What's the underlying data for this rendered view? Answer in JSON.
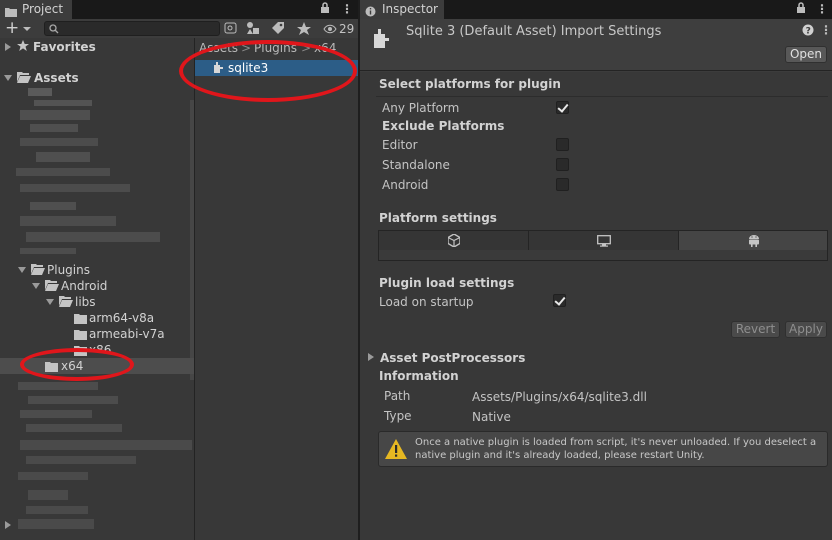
{
  "project_tab": {
    "title": "Project",
    "count": "29"
  },
  "inspector_tab": {
    "title": "Inspector"
  },
  "search": {
    "placeholder": ""
  },
  "tree": {
    "favorites": "Favorites",
    "assets": "Assets",
    "plugins": "Plugins",
    "android": "Android",
    "libs": "libs",
    "arm64": "arm64-v8a",
    "armeabi": "armeabi-v7a",
    "x86": "x86",
    "x64": "x64"
  },
  "breadcrumb": {
    "part1": "Assets",
    "sep1": ">",
    "part2": "Plugins",
    "sep2": ">",
    "part3": "x64"
  },
  "file_list": {
    "selected": "sqlite3"
  },
  "inspector": {
    "title": "Sqlite 3 (Default Asset) Import Settings",
    "open_button": "Open",
    "select_platforms_header": "Select platforms for plugin",
    "any_platform_label": "Any Platform",
    "any_platform_checked": true,
    "exclude_platforms_header": "Exclude Platforms",
    "exclude": [
      {
        "label": "Editor",
        "checked": false
      },
      {
        "label": "Standalone",
        "checked": false
      },
      {
        "label": "Android",
        "checked": false
      }
    ],
    "platform_settings_header": "Platform settings",
    "platform_tabs": [
      "unity-icon",
      "monitor-icon",
      "android-icon"
    ],
    "plugin_load_header": "Plugin load settings",
    "load_on_startup_label": "Load on startup",
    "load_on_startup_checked": true,
    "revert_button": "Revert",
    "apply_button": "Apply",
    "asset_postprocessors": "Asset PostProcessors",
    "information_header": "Information",
    "path_label": "Path",
    "path_value": "Assets/Plugins/x64/sqlite3.dll",
    "type_label": "Type",
    "type_value": "Native",
    "warning_line1": "Once a native plugin is loaded from script, it's never unloaded. If you deselect a",
    "warning_line2": "native plugin and it's already loaded, please restart Unity."
  },
  "colors": {
    "selection": "#2c5d87",
    "annotation_red": "#e0161b",
    "warning_yellow": "#e6b822"
  }
}
